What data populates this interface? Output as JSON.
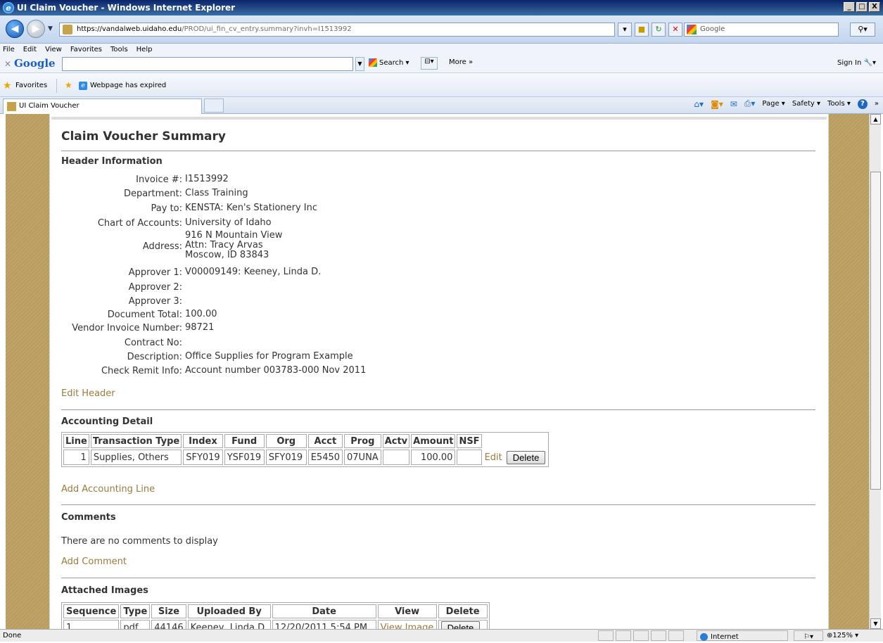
{
  "window": {
    "title": "UI Claim Voucher - Windows Internet Explorer",
    "controls": [
      "_",
      "□",
      "X"
    ]
  },
  "address": {
    "url_host": "https://vandalweb.uidaho.edu",
    "url_path": "/PROD/ui_fin_cv_entry.summary?invh=I1513992",
    "search_placeholder": "Google"
  },
  "menu": [
    "File",
    "Edit",
    "View",
    "Favorites",
    "Tools",
    "Help"
  ],
  "googlebar": {
    "logo_a": "Goo",
    "logo_b": "gle",
    "search_label": "Search ▾",
    "more_label": "More »",
    "signin_label": "Sign In"
  },
  "favorites": {
    "label": "Favorites",
    "item": "Webpage has expired"
  },
  "tab": {
    "label": "UI Claim Voucher"
  },
  "commandbar": {
    "page": "Page ▾",
    "safety": "Safety ▾",
    "tools": "Tools ▾"
  },
  "page": {
    "title": "Claim Voucher Summary",
    "header_section": "Header Information",
    "fields": [
      {
        "label": "Invoice #:",
        "value": "I1513992"
      },
      {
        "label": "Department:",
        "value": "Class Training"
      },
      {
        "label": "Pay to:",
        "value": "KENSTA: Ken's Stationery Inc"
      },
      {
        "label": "Chart of Accounts:",
        "value": "University of Idaho"
      },
      {
        "label": "Address:",
        "value_lines": [
          "916 N Mountain View",
          "Attn: Tracy Arvas",
          "Moscow, ID 83843"
        ]
      },
      {
        "label": "Approver 1:",
        "value": "V00009149: Keeney, Linda D."
      },
      {
        "label": "Approver 2:",
        "value": ""
      },
      {
        "label": "Approver 3:",
        "value": ""
      },
      {
        "label": "Document Total:",
        "value": "100.00"
      },
      {
        "label": "Vendor Invoice Number:",
        "value": "98721"
      },
      {
        "label": "Contract No:",
        "value": ""
      },
      {
        "label": "Description:",
        "value": "Office Supplies for Program Example"
      },
      {
        "label": "Check Remit Info:",
        "value": "Account number 003783-000 Nov 2011"
      }
    ],
    "edit_header": "Edit Header",
    "accounting_section": "Accounting Detail",
    "accounting_columns": [
      "Line",
      "Transaction Type",
      "Index",
      "Fund",
      "Org",
      "Acct",
      "Prog",
      "Actv",
      "Amount",
      "NSF"
    ],
    "accounting_rows": [
      {
        "line": "1",
        "type": "Supplies, Others",
        "index": "SFY019",
        "fund": "YSF019",
        "org": "SFY019",
        "acct": "E5450",
        "prog": "07UNA",
        "actv": "",
        "amount": "100.00",
        "nsf": "",
        "edit": "Edit",
        "delete": "Delete"
      }
    ],
    "add_accounting": "Add Accounting Line",
    "comments_section": "Comments",
    "no_comments": "There are no comments to display",
    "add_comment": "Add Comment",
    "images_section": "Attached Images",
    "images_columns": [
      "Sequence",
      "Type",
      "Size",
      "Uploaded By",
      "Date",
      "View",
      "Delete"
    ],
    "images_rows": [
      {
        "sequence": "1",
        "type": "pdf",
        "size": "44146",
        "uploaded_by": "Keeney, Linda D.",
        "date": "12/20/2011 5:54 PM",
        "view": "View Image",
        "delete": "Delete"
      }
    ]
  },
  "status": {
    "text": "Done",
    "zone": "Internet",
    "zoom": "125%"
  }
}
